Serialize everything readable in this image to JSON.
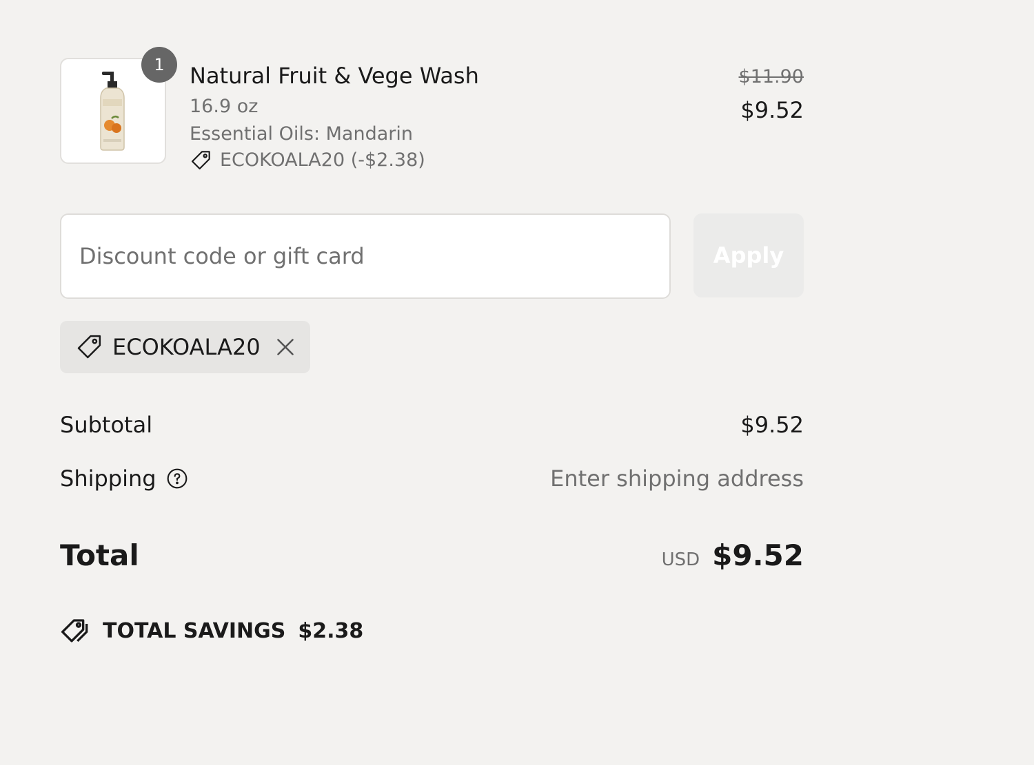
{
  "line_item": {
    "quantity": "1",
    "name": "Natural Fruit & Vege Wash",
    "size": "16.9 oz",
    "variant": "Essential Oils: Mandarin",
    "discount": "ECOKOALA20 (-$2.38)",
    "original_price": "$11.90",
    "price": "$9.52",
    "thumbnail_icon": "product-bottle-icon"
  },
  "discount": {
    "placeholder": "Discount code or gift card",
    "value": "",
    "apply_label": "Apply",
    "applied_code": "ECOKOALA20"
  },
  "totals": {
    "subtotal_label": "Subtotal",
    "subtotal_value": "$9.52",
    "shipping_label": "Shipping",
    "shipping_value": "Enter shipping address",
    "total_label": "Total",
    "currency": "USD",
    "total_value": "$9.52"
  },
  "savings": {
    "label": "TOTAL SAVINGS",
    "amount": "$2.38"
  },
  "colors": {
    "background": "#f3f2f0",
    "text": "#1a1a1a",
    "muted": "#707070",
    "badge": "#666666",
    "chip": "#e6e5e3",
    "apply_disabled": "#ebebea"
  }
}
